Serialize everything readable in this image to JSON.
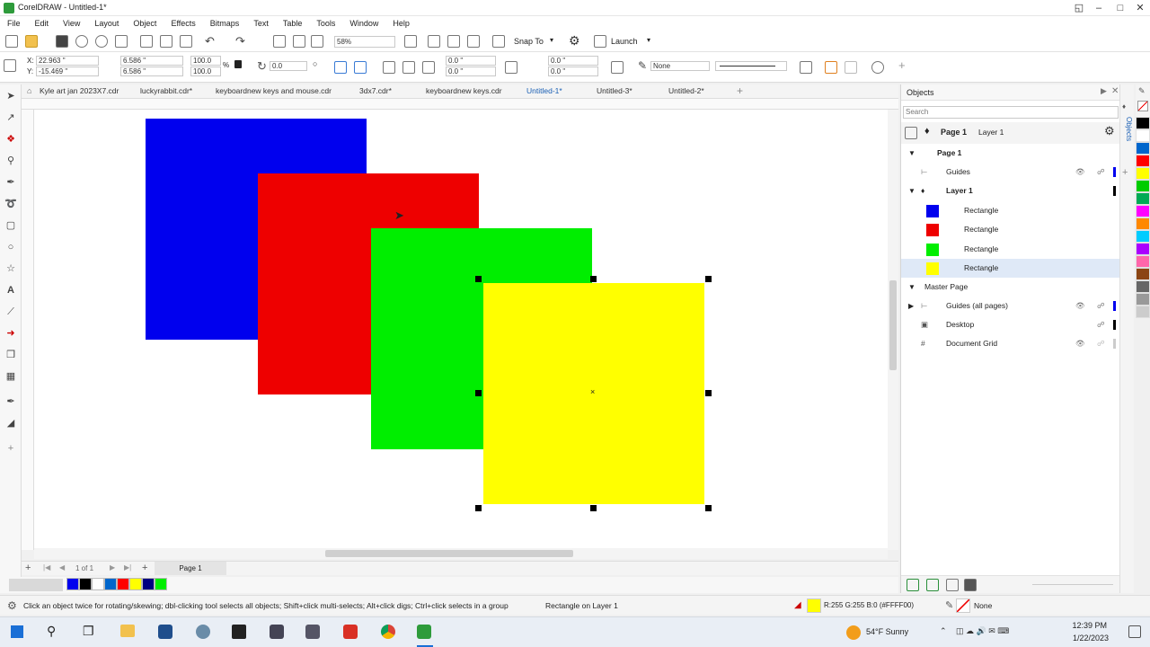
{
  "window": {
    "title": "CorelDRAW - Untitled-1*",
    "minimize": "–",
    "maximize": "□",
    "close": "✕"
  },
  "menu": [
    "File",
    "Edit",
    "View",
    "Layout",
    "Object",
    "Effects",
    "Bitmaps",
    "Text",
    "Table",
    "Tools",
    "Window",
    "Help"
  ],
  "toolbar": {
    "zoom": "58%",
    "snap_to": "Snap To",
    "launch": "Launch"
  },
  "property_bar": {
    "x": "22.963 \"",
    "y": "-15.469 \"",
    "width": "6.586 \"",
    "height": "6.586 \"",
    "scale_x": "100.0",
    "scale_y": "100.0",
    "percent": "%",
    "angle": "0.0",
    "corner_top": "0.0 \"",
    "corner_bottom": "0.0 \"",
    "corner_top_r": "0.0 \"",
    "corner_bottom_r": "0.0 \"",
    "outline": "None"
  },
  "doc_tabs": [
    "Kyle art jan 2023X7.cdr",
    "luckyrabbit.cdr*",
    "keyboardnew keys and mouse.cdr",
    "3dx7.cdr*",
    "keyboardnew keys.cdr",
    "Untitled-1*",
    "Untitled-3*",
    "Untitled-2*"
  ],
  "active_tab_index": 5,
  "rectangles": [
    {
      "name": "blue",
      "color": "#0000ee"
    },
    {
      "name": "red",
      "color": "#ee0000"
    },
    {
      "name": "green",
      "color": "#00ee00"
    },
    {
      "name": "yellow",
      "color": "#ffff00"
    }
  ],
  "pager": {
    "count": "1 of 1",
    "page_tab": "Page 1"
  },
  "status": {
    "hint": "Click an object twice for rotating/skewing; dbl-clicking tool selects all objects; Shift+click multi-selects; Alt+click digs; Ctrl+click selects in a group",
    "selection": "Rectangle on Layer 1",
    "fill_info": "R:255 G:255 B:0 (#FFFF00)",
    "outline_info": "None"
  },
  "objects_panel": {
    "title": "Objects",
    "search_placeholder": "Search",
    "page_label": "Page 1",
    "layer_label": "Layer 1",
    "tree": {
      "page": "Page 1",
      "guides": "Guides",
      "layer": "Layer 1",
      "items": [
        {
          "label": "Rectangle",
          "color": "#0000ee"
        },
        {
          "label": "Rectangle",
          "color": "#ee0000"
        },
        {
          "label": "Rectangle",
          "color": "#00ee00"
        },
        {
          "label": "Rectangle",
          "color": "#ffff00"
        }
      ],
      "master_page": "Master Page",
      "guides_all": "Guides (all pages)",
      "desktop": "Desktop",
      "document_grid": "Document Grid"
    }
  },
  "side_tab": "Objects",
  "palette_colors": [
    "#000000",
    "#ffffff",
    "#0066cc",
    "#ff0000",
    "#ffff00",
    "#00cc00",
    "#00aa55",
    "#ff00ff",
    "#ff8800",
    "#00ccff",
    "#aa00ff",
    "#ff66aa",
    "#8b4513",
    "#666666",
    "#999999",
    "#cccccc"
  ],
  "bottom_palette": [
    "#0000ee",
    "#000000",
    "#ffffff",
    "#0066cc",
    "#ff0000",
    "#ffff00",
    "#000080",
    "#00ee00"
  ],
  "taskbar": {
    "weather": "54°F Sunny",
    "time": "12:39 PM",
    "date": "1/22/2023"
  }
}
